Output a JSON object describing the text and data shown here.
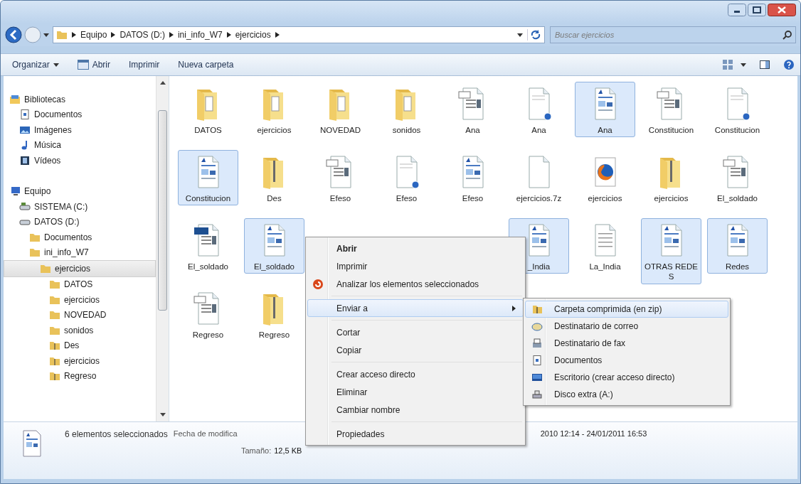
{
  "nav": {
    "breadcrumb": [
      "Equipo",
      "DATOS (D:)",
      "ini_info_W7",
      "ejercicios"
    ],
    "search": {
      "placeholder": "Buscar ejercicios"
    }
  },
  "toolbar": {
    "buttons": [
      {
        "label": "Organizar",
        "kind": "menu"
      },
      {
        "label": "Abrir",
        "kind": "open"
      },
      {
        "label": "Imprimir",
        "kind": "plain"
      },
      {
        "label": "Nueva carpeta",
        "kind": "plain"
      }
    ]
  },
  "sidebar": {
    "items": [
      {
        "label": "Bibliotecas",
        "kind": "library",
        "selected": false,
        "children": [
          {
            "label": "Documentos",
            "kind": "documents",
            "selected": false
          },
          {
            "label": "Imágenes",
            "kind": "pictures",
            "selected": false
          },
          {
            "label": "Música",
            "kind": "music",
            "selected": false
          },
          {
            "label": "Vídeos",
            "kind": "videos",
            "selected": false
          }
        ]
      },
      {
        "label": "Equipo",
        "kind": "computer",
        "selected": false,
        "children": [
          {
            "label": "SISTEMA (C:)",
            "kind": "system-drive",
            "selected": false
          },
          {
            "label": "DATOS (D:)",
            "kind": "drive",
            "selected": false,
            "children": [
              {
                "label": "Documentos",
                "kind": "folder",
                "selected": false
              },
              {
                "label": "ini_info_W7",
                "kind": "folder",
                "selected": false,
                "children": [
                  {
                    "label": "ejercicios",
                    "kind": "folder",
                    "selected": true,
                    "children": [
                      {
                        "label": "DATOS",
                        "kind": "folder",
                        "selected": false
                      },
                      {
                        "label": "ejercicios",
                        "kind": "folder",
                        "selected": false
                      },
                      {
                        "label": "NOVEDAD",
                        "kind": "folder",
                        "selected": false
                      },
                      {
                        "label": "sonidos",
                        "kind": "folder",
                        "selected": false
                      },
                      {
                        "label": "Des",
                        "kind": "zip",
                        "selected": false
                      },
                      {
                        "label": "ejercicios",
                        "kind": "zip",
                        "selected": false
                      },
                      {
                        "label": "Regreso",
                        "kind": "zip",
                        "selected": false
                      }
                    ]
                  }
                ]
              }
            ]
          }
        ]
      }
    ]
  },
  "files": {
    "rows": [
      [
        {
          "name": "DATOS",
          "kind": "folder",
          "selected": false
        },
        {
          "name": "ejercicios",
          "kind": "folder",
          "selected": false
        },
        {
          "name": "NOVEDAD",
          "kind": "folder",
          "selected": false
        },
        {
          "name": "sonidos",
          "kind": "folder",
          "selected": false
        },
        {
          "name": "Ana",
          "kind": "doc",
          "selected": false
        },
        {
          "name": "Ana",
          "kind": "web",
          "selected": false
        },
        {
          "name": "Ana",
          "kind": "rtf",
          "selected": true
        },
        {
          "name": "Constitucion",
          "kind": "doc",
          "selected": false
        },
        {
          "name": "Constitucion",
          "kind": "web",
          "selected": false
        }
      ],
      [
        {
          "name": "Constitucion",
          "kind": "rtf",
          "selected": true
        },
        {
          "name": "Des",
          "kind": "zip",
          "selected": false
        },
        {
          "name": "Efeso",
          "kind": "doc",
          "selected": false
        },
        {
          "name": "Efeso",
          "kind": "web",
          "selected": false
        },
        {
          "name": "Efeso",
          "kind": "rtf",
          "selected": false
        },
        {
          "name": "ejercicios.7z",
          "kind": "blank",
          "selected": false
        },
        {
          "name": "ejercicios",
          "kind": "firefox",
          "selected": false
        },
        {
          "name": "ejercicios",
          "kind": "zip",
          "selected": false
        },
        {
          "name": "El_soldado",
          "kind": "doc",
          "selected": false
        }
      ],
      [
        {
          "name": "El_soldado",
          "kind": "odf",
          "selected": false
        },
        {
          "name": "El_soldado",
          "kind": "rtf",
          "selected": true
        },
        {
          "kind": "covered"
        },
        {
          "kind": "covered"
        },
        {
          "kind": "covered"
        },
        {
          "name": "_India",
          "kind": "rtf",
          "selected": true
        },
        {
          "name": "La_India",
          "kind": "text",
          "selected": false
        },
        {
          "name": "OTRAS REDES",
          "kind": "rtf",
          "selected": true
        },
        {
          "name": "Redes",
          "kind": "rtf",
          "selected": true
        }
      ],
      [
        {
          "name": "Regreso",
          "kind": "doc",
          "selected": false
        },
        {
          "name": "Regreso",
          "kind": "zip",
          "selected": false
        }
      ]
    ]
  },
  "context_menu": {
    "items": [
      {
        "kind": "item",
        "label": "Abrir",
        "default": true,
        "selected": false
      },
      {
        "kind": "item",
        "label": "Imprimir",
        "default": false,
        "selected": false
      },
      {
        "kind": "scan-item",
        "label": "Analizar los elementos seleccionados",
        "default": false,
        "selected": false
      },
      {
        "kind": "separator"
      },
      {
        "kind": "submenu-item",
        "label": "Enviar a",
        "default": false,
        "selected": true
      },
      {
        "kind": "separator"
      },
      {
        "kind": "item",
        "label": "Cortar",
        "default": false,
        "selected": false
      },
      {
        "kind": "item",
        "label": "Copiar",
        "default": false,
        "selected": false
      },
      {
        "kind": "separator"
      },
      {
        "kind": "item",
        "label": "Crear acceso directo",
        "default": false,
        "selected": false
      },
      {
        "kind": "item",
        "label": "Eliminar",
        "default": false,
        "selected": false
      },
      {
        "kind": "item",
        "label": "Cambiar nombre",
        "default": false,
        "selected": false
      },
      {
        "kind": "separator"
      },
      {
        "kind": "item",
        "label": "Propiedades",
        "default": false,
        "selected": false
      }
    ]
  },
  "submenu": {
    "items": [
      {
        "label": "Carpeta comprimida (en zip)",
        "kind": "zip",
        "selected": true
      },
      {
        "label": "Destinatario de correo",
        "kind": "mail",
        "selected": false
      },
      {
        "label": "Destinatario de fax",
        "kind": "fax",
        "selected": false
      },
      {
        "label": "Documentos",
        "kind": "documents",
        "selected": false
      },
      {
        "label": "Escritorio (crear acceso directo)",
        "kind": "desktop",
        "selected": false
      },
      {
        "label": "Disco extra (A:)",
        "kind": "drive",
        "selected": false
      }
    ]
  },
  "status_bar": {
    "summary": "6 elementos seleccionados",
    "date_label": "Fecha de modifica",
    "date_value": "2010 12:14 - 24/01/2011 16:53",
    "size_label": "Tamaño:",
    "size_value": "12,5 KB"
  }
}
